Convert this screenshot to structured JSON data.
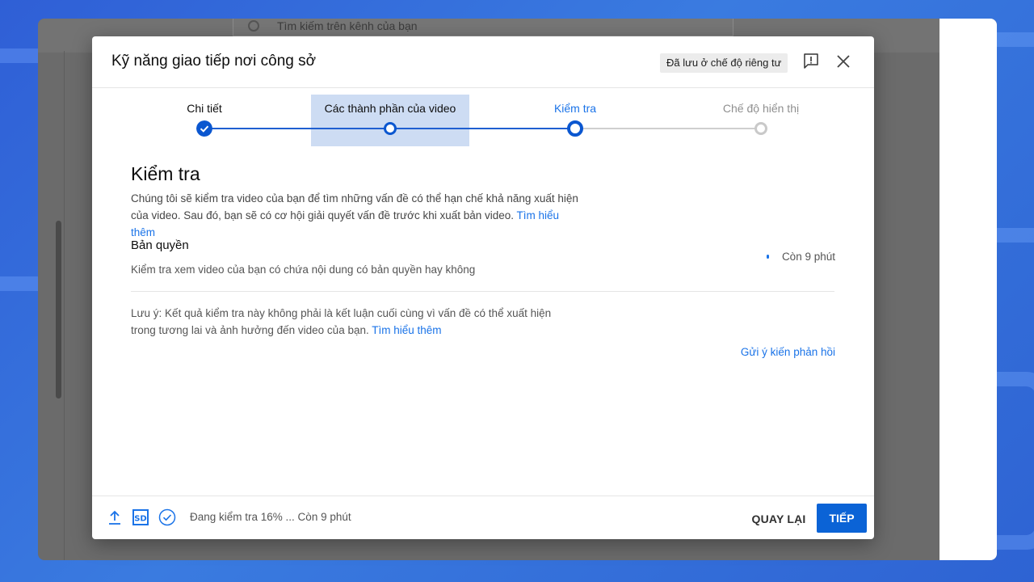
{
  "search": {
    "placeholder": "Tìm kiếm trên kênh của bạn"
  },
  "dialog": {
    "title": "Kỹ năng giao tiếp nơi công sở",
    "saved_status": "Đã lưu ở chế độ riêng tư"
  },
  "stepper": {
    "steps": [
      {
        "label": "Chi tiết",
        "state": "done"
      },
      {
        "label": "Các thành phần của video",
        "state": "done"
      },
      {
        "label": "Kiểm tra",
        "state": "active"
      },
      {
        "label": "Chế độ hiển thị",
        "state": "pending"
      }
    ]
  },
  "content": {
    "title": "Kiểm tra",
    "description": "Chúng tôi sẽ kiểm tra video của bạn để tìm những vấn đề có thể hạn chế khả năng xuất hiện của video. Sau đó, bạn sẽ có cơ hội giải quyết vấn đề trước khi xuất bản video.",
    "learn_more": "Tìm hiểu thêm",
    "copyright": {
      "title": "Bản quyền",
      "description": "Kiểm tra xem video của bạn có chứa nội dung có bản quyền hay không",
      "status": "Còn 9 phút"
    },
    "note": "Lưu ý: Kết quả kiểm tra này không phải là kết luận cuối cùng vì vấn đề có thể xuất hiện trong tương lai và ảnh hưởng đến video của bạn.",
    "note_link": "Tìm hiểu thêm",
    "feedback_link": "Gửi ý kiến phản hồi"
  },
  "footer": {
    "status": "Đang kiểm tra 16% ... Còn 9 phút",
    "back_label": "QUAY LẠI",
    "next_label": "TIẾP"
  },
  "colors": {
    "accent": "#1a73e8",
    "primary_button": "#0b63d6",
    "step_highlight": "#cddcf3"
  },
  "icons": [
    "search-icon",
    "feedback-icon",
    "close-icon",
    "check-icon",
    "upload-icon",
    "sd-icon",
    "check-circle-icon"
  ]
}
